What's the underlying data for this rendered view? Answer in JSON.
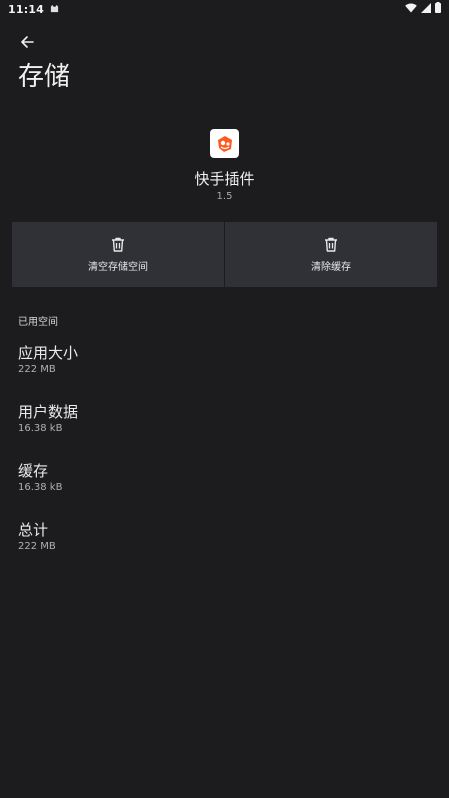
{
  "status_bar": {
    "time": "11:14"
  },
  "header": {
    "title": "存储"
  },
  "app": {
    "name": "快手插件",
    "version": "1.5",
    "icon_color": "#ff5a1f"
  },
  "actions": {
    "clear_storage_label": "清空存储空间",
    "clear_cache_label": "清除缓存"
  },
  "storage": {
    "section_title": "已用空间",
    "items": [
      {
        "title": "应用大小",
        "value": "222 MB"
      },
      {
        "title": "用户数据",
        "value": "16.38 kB"
      },
      {
        "title": "缓存",
        "value": "16.38 kB"
      },
      {
        "title": "总计",
        "value": "222 MB"
      }
    ]
  }
}
